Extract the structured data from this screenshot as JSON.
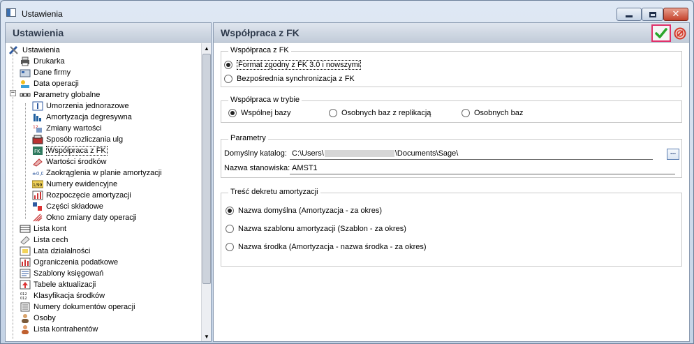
{
  "window": {
    "title": "Ustawienia",
    "controls": {
      "minimize": "minimize",
      "maximize": "maximize",
      "close": "✕"
    }
  },
  "left_panel": {
    "header": "Ustawienia",
    "tree": [
      {
        "label": "Ustawienia",
        "icon": "tools-icon"
      },
      {
        "label": "Drukarka",
        "icon": "printer-icon"
      },
      {
        "label": "Dane firmy",
        "icon": "company-icon"
      },
      {
        "label": "Data operacji",
        "icon": "date-icon"
      },
      {
        "label": "Parametry globalne",
        "icon": "parameters-icon"
      },
      {
        "label": "Umorzenia jednorazowe",
        "icon": "writeoff-icon"
      },
      {
        "label": "Amortyzacja degresywna",
        "icon": "degressive-icon"
      },
      {
        "label": "Zmiany wartości",
        "icon": "value-change-icon"
      },
      {
        "label": "Sposób rozliczania ulg",
        "icon": "relief-icon"
      },
      {
        "label": "Współpraca z FK",
        "icon": "fk-icon"
      },
      {
        "label": "Wartości środków",
        "icon": "asset-value-icon"
      },
      {
        "label": "Zaokrąglenia w planie amortyzacji",
        "icon": "rounding-icon"
      },
      {
        "label": "Numery ewidencyjne",
        "icon": "numbering-icon"
      },
      {
        "label": "Rozpoczęcie amortyzacji",
        "icon": "start-icon"
      },
      {
        "label": "Części składowe",
        "icon": "components-icon"
      },
      {
        "label": "Okno zmiany daty operacji",
        "icon": "date-window-icon"
      },
      {
        "label": "Lista kont",
        "icon": "accounts-icon"
      },
      {
        "label": "Lista cech",
        "icon": "tags-icon"
      },
      {
        "label": "Lata działalności",
        "icon": "years-icon"
      },
      {
        "label": "Ograniczenia podatkowe",
        "icon": "tax-limits-icon"
      },
      {
        "label": "Szablony księgowań",
        "icon": "templates-icon"
      },
      {
        "label": "Tabele aktualizacji",
        "icon": "update-tables-icon"
      },
      {
        "label": "Klasyfikacja środków",
        "icon": "classification-icon"
      },
      {
        "label": "Numery dokumentów operacji",
        "icon": "doc-numbers-icon"
      },
      {
        "label": "Osoby",
        "icon": "person-icon"
      },
      {
        "label": "Lista kontrahentów",
        "icon": "contractors-icon"
      }
    ],
    "selected": "Współpraca z FK"
  },
  "right_panel": {
    "header": "Współpraca z FK",
    "ok_icon": "checkmark-icon",
    "cancel_icon": "cancel-icon",
    "group_fk": {
      "title": "Współpraca z FK",
      "option1": "Format zgodny z FK 3.0 i nowszymi",
      "option2": "Bezpośrednia synchronizacja z FK"
    },
    "group_mode": {
      "title": "Współpraca w trybie",
      "option1": "Wspólnej bazy",
      "option2": "Osobnych baz z replikacją",
      "option3": "Osobnych baz"
    },
    "group_params": {
      "title": "Parametry",
      "catalog_label": "Domyślny katalog:",
      "catalog_value_start": "C:\\Users\\",
      "catalog_value_end": "\\Documents\\Sage\\",
      "browse_label": "...",
      "station_label": "Nazwa stanowiska:",
      "station_value": "AMST1"
    },
    "group_decree": {
      "title": "Treść dekretu amortyzacji",
      "option1": "Nazwa domyślna (Amortyzacja - za okres)",
      "option2": "Nazwa szablonu amortyzacji (Szablon - za okres)",
      "option3": "Nazwa środka (Amortyzacja - nazwa środka - za okres)"
    }
  },
  "colors": {
    "ok_highlight": "#e0306a",
    "ok_check": "#2aa52a",
    "cancel": "#d33a2c",
    "header_text": "#2e3a4c"
  }
}
